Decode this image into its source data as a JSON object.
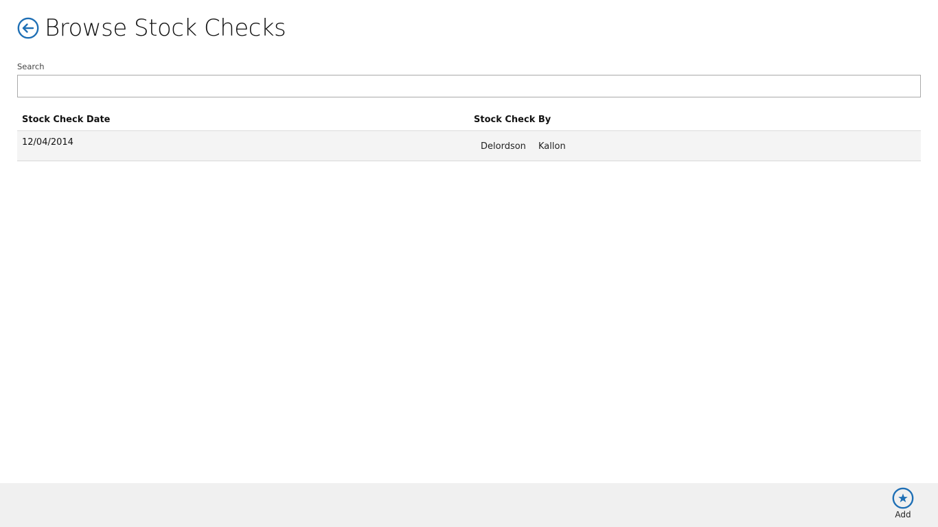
{
  "header": {
    "title": "Browse Stock Checks",
    "back_icon": "back-arrow-icon"
  },
  "search": {
    "label": "Search",
    "value": "",
    "placeholder": ""
  },
  "grid": {
    "columns": [
      "Stock Check Date",
      "Stock Check By"
    ],
    "rows": [
      {
        "date": "12/04/2014",
        "first_name": "Delordson",
        "last_name": "Kallon"
      }
    ]
  },
  "app_bar": {
    "add_label": "Add",
    "add_icon": "star-icon"
  },
  "colors": {
    "accent": "#1e6fb5",
    "app_bar_bg": "#f0f0f0",
    "row_bg": "#f4f4f4"
  }
}
